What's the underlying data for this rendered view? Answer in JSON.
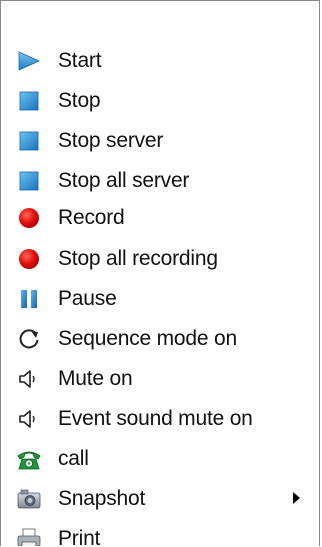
{
  "menu": {
    "items": [
      {
        "label": "Start",
        "icon": "play-icon"
      },
      {
        "label": "Stop",
        "icon": "stop-icon"
      },
      {
        "label": "Stop server",
        "icon": "stop-icon"
      },
      {
        "label": "Stop all server",
        "icon": "stop-icon"
      },
      {
        "label": "Record",
        "icon": "record-icon"
      },
      {
        "label": "Stop all recording",
        "icon": "record-icon"
      },
      {
        "label": "Pause",
        "icon": "pause-icon"
      },
      {
        "label": "Sequence mode on",
        "icon": "rotate-arrow-icon"
      },
      {
        "label": "Mute on",
        "icon": "speaker-icon"
      },
      {
        "label": "Event sound mute on",
        "icon": "speaker-icon"
      },
      {
        "label": "call",
        "icon": "telephone-icon"
      },
      {
        "label": "Snapshot",
        "icon": "camera-icon",
        "has_submenu": true
      },
      {
        "label": "Print",
        "icon": "printer-icon"
      }
    ]
  },
  "colors": {
    "play": "#2a8fd0",
    "stop": "#1f8fd6",
    "record": "#e01010",
    "pause": "#1f7fd0",
    "telephone": "#1c9a3a"
  }
}
